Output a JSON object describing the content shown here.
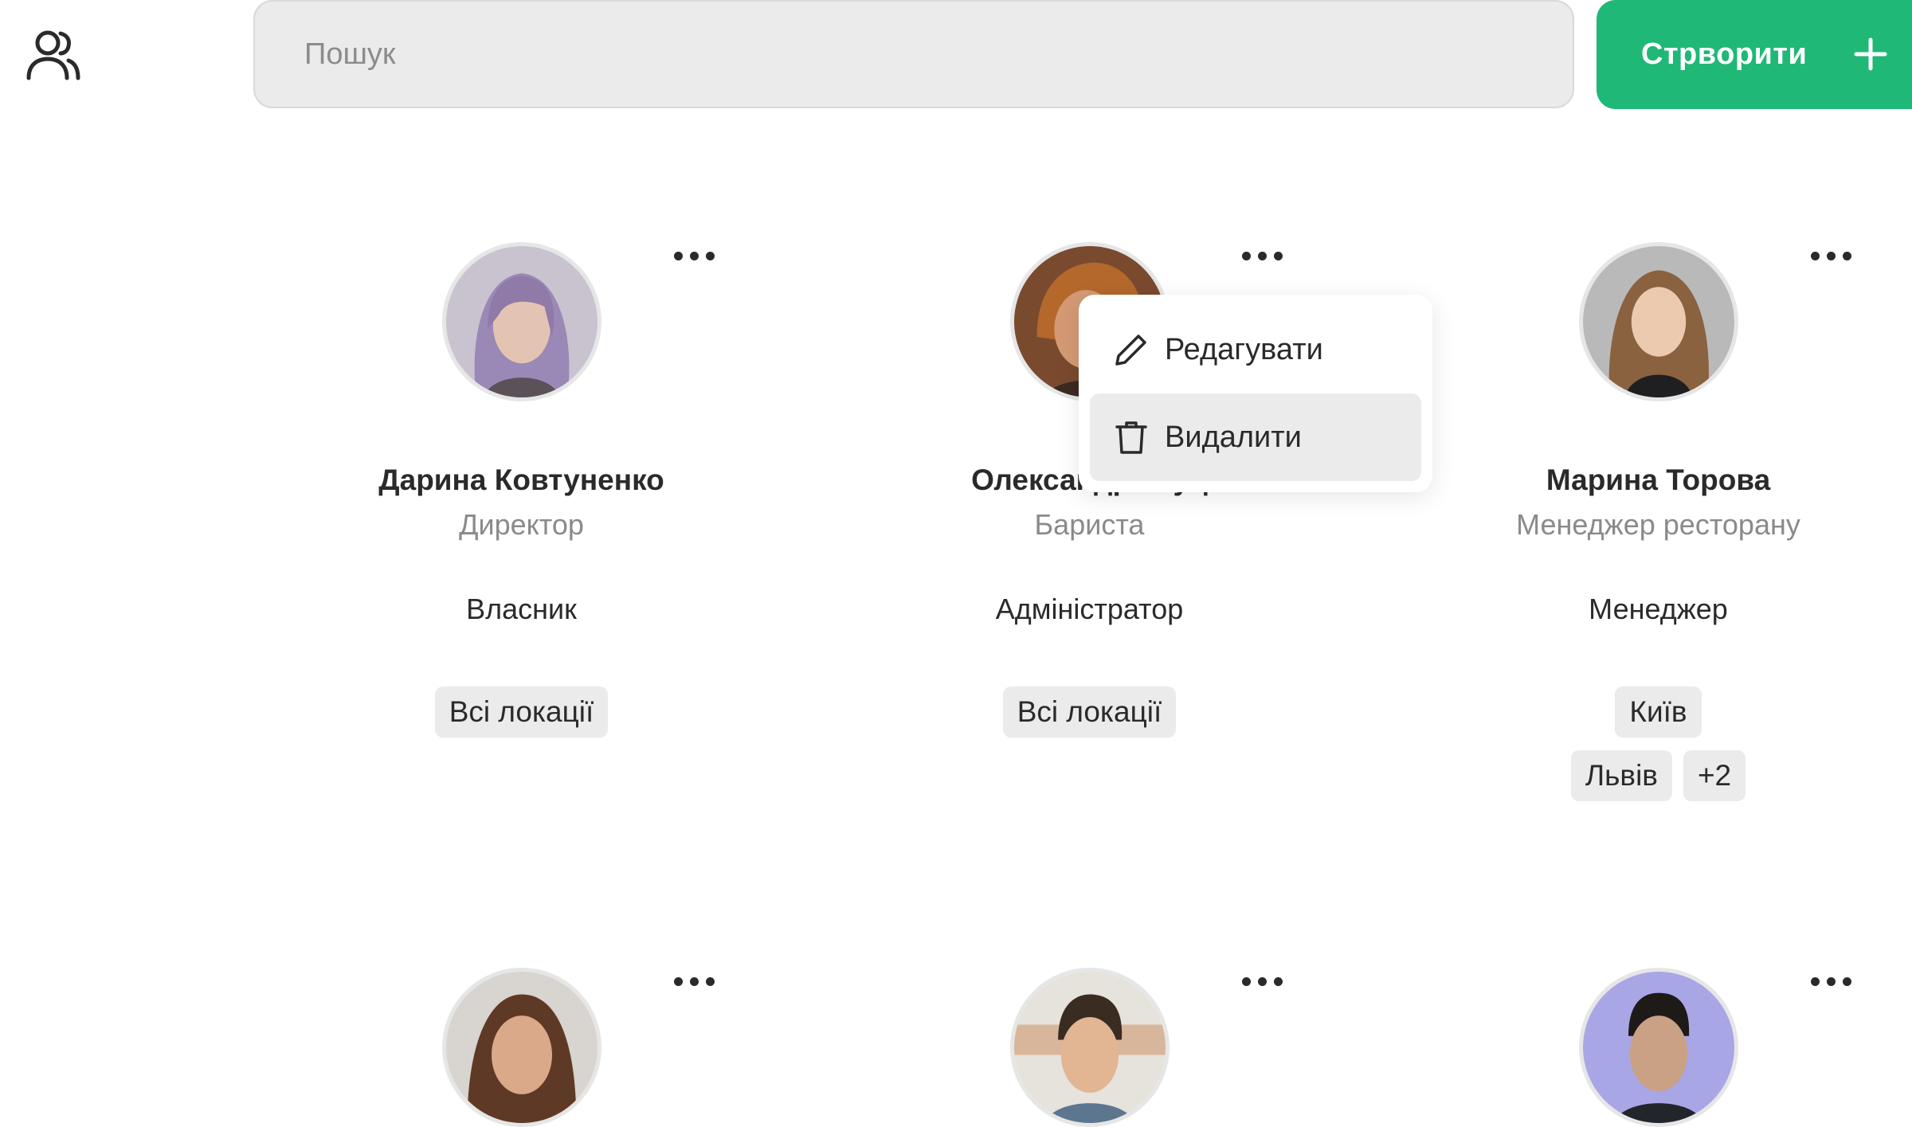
{
  "search": {
    "placeholder": "Пошук"
  },
  "header": {
    "create_label": "Стрворити"
  },
  "colors": {
    "accent": "#1fb876",
    "tag_bg": "#ebebeb"
  },
  "users": [
    {
      "name": "Дарина Ковтуненко",
      "position": "Директор",
      "role": "Власник",
      "locations": [
        "Всі локації"
      ]
    },
    {
      "name": "Олександра Куц",
      "position": "Бариста",
      "role": "Адміністратор",
      "locations": [
        "Всі локації"
      ]
    },
    {
      "name": "Марина Торова",
      "position": "Менеджер ресторану",
      "role": "Менеджер",
      "locations": [
        "Київ",
        "Львів"
      ],
      "more_locations": "+2"
    }
  ],
  "context_menu": {
    "edit_label": "Редагувати",
    "delete_label": "Видалити"
  }
}
